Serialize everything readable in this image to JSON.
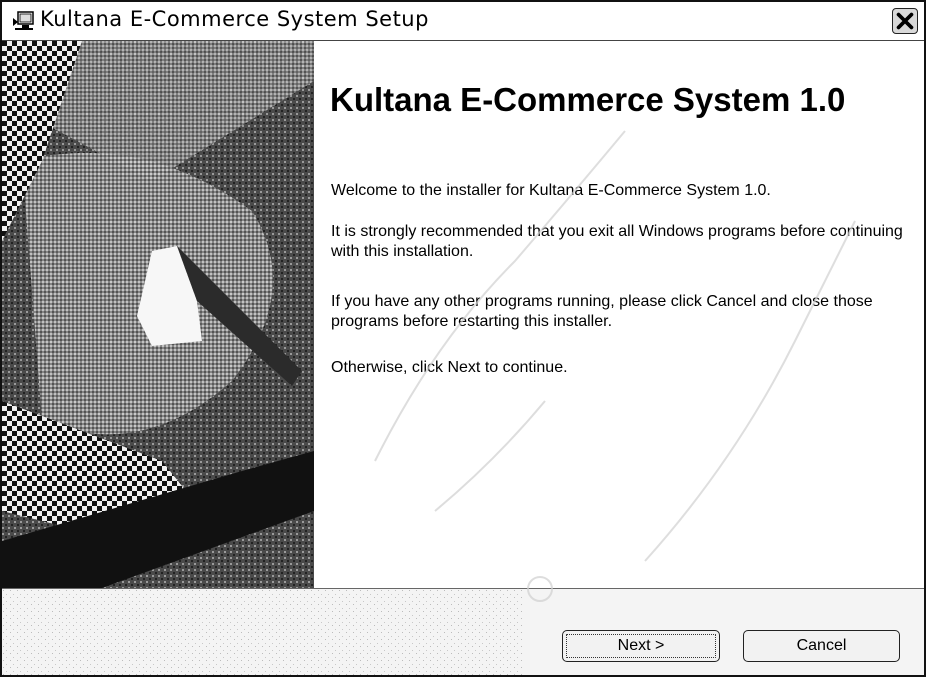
{
  "window": {
    "title": "Kultana E-Commerce System Setup",
    "app_icon": "installer-icon",
    "close_icon": "close-icon"
  },
  "sidebar": {
    "image": "installer-wizard-graphic"
  },
  "main": {
    "heading": "Kultana E-Commerce System 1.0",
    "paragraphs": [
      "Welcome to the installer for Kultana E-Commerce System 1.0.",
      "It is strongly recommended that you exit all Windows programs before continuing with this installation.",
      "If you have any other programs running, please click Cancel and close those programs before restarting this installer.",
      "Otherwise, click Next to continue."
    ]
  },
  "footer": {
    "next_label": "Next >",
    "cancel_label": "Cancel"
  }
}
